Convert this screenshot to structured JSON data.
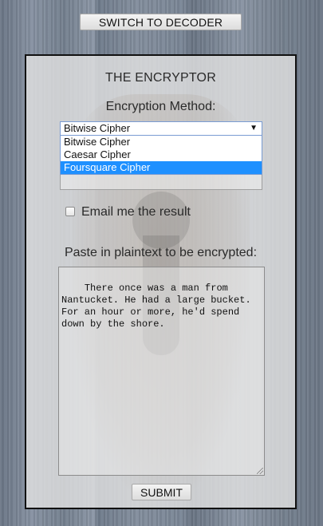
{
  "header": {
    "switch_button_label": "SWITCH TO DECODER"
  },
  "panel": {
    "title": "THE ENCRYPTOR",
    "method_label": "Encryption Method:",
    "method_select": {
      "selected_value": "Bitwise Cipher",
      "options": [
        "Bitwise Cipher",
        "Caesar Cipher",
        "Foursquare Cipher"
      ],
      "highlighted_option": "Foursquare Cipher"
    },
    "email_checkbox": {
      "label": "Email me the result",
      "checked": false
    },
    "plaintext_label": "Paste in plaintext to be encrypted:",
    "plaintext_value": "There once was a man from\nNantucket. He had a large bucket.\nFor an hour or more, he'd spend\ndown by the shore.",
    "submit_label": "SUBMIT"
  },
  "icons": {
    "dropdown_arrow": "chevron-down-icon",
    "resize_handle": "resize-grip-icon"
  },
  "colors": {
    "highlight": "#1e90ff",
    "panel_border": "#111111",
    "select_border": "#7a9cd3"
  }
}
